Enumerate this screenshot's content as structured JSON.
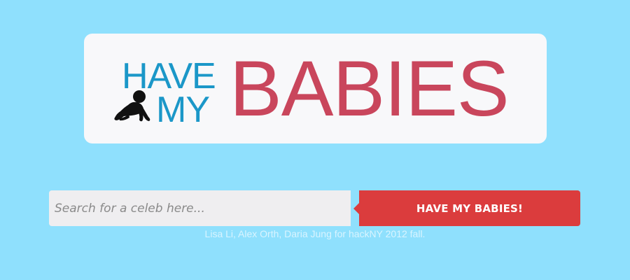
{
  "logo": {
    "line1": "HAVE",
    "line2": "MY",
    "word": "BABIES",
    "icon": "crawling-baby-icon"
  },
  "search": {
    "placeholder": "Search for a celeb here...",
    "value": ""
  },
  "submit": {
    "label": "HAVE MY BABIES!"
  },
  "footer": {
    "credits": "Lisa Li, Alex Orth, Daria Jung for hackNY 2012 fall."
  },
  "colors": {
    "background": "#8fe0fd",
    "card": "#f8f8fa",
    "blue": "#1b97c8",
    "pink": "#c9465c",
    "button": "#db3c3d",
    "input": "#efeef0"
  }
}
